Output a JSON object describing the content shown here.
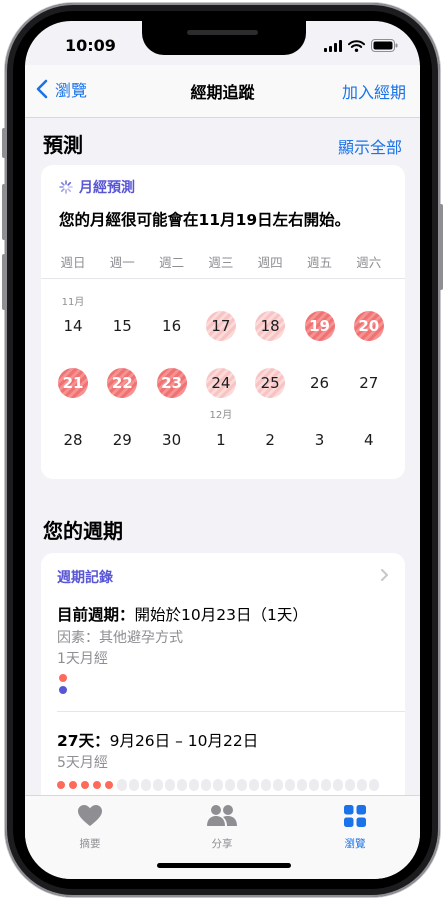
{
  "status": {
    "time": "10:09"
  },
  "nav": {
    "back_label": "瀏覽",
    "title": "經期追蹤",
    "action_label": "加入經期"
  },
  "prediction": {
    "section_title": "預測",
    "show_all_label": "顯示全部",
    "card_title": "月經預測",
    "message": "您的月經很可能會在11月19日左右開始。",
    "weekdays": [
      "週日",
      "週一",
      "週二",
      "週三",
      "週四",
      "週五",
      "週六"
    ],
    "weeks": [
      {
        "month_label": "11月",
        "month_col": 0,
        "days": [
          {
            "d": "14",
            "s": ""
          },
          {
            "d": "15",
            "s": ""
          },
          {
            "d": "16",
            "s": ""
          },
          {
            "d": "17",
            "s": "light"
          },
          {
            "d": "18",
            "s": "light"
          },
          {
            "d": "19",
            "s": "dark"
          },
          {
            "d": "20",
            "s": "dark"
          }
        ]
      },
      {
        "month_label": "",
        "month_col": -1,
        "days": [
          {
            "d": "21",
            "s": "dark"
          },
          {
            "d": "22",
            "s": "dark"
          },
          {
            "d": "23",
            "s": "dark"
          },
          {
            "d": "24",
            "s": "light"
          },
          {
            "d": "25",
            "s": "light"
          },
          {
            "d": "26",
            "s": ""
          },
          {
            "d": "27",
            "s": ""
          }
        ]
      },
      {
        "month_label": "12月",
        "month_col": 3,
        "days": [
          {
            "d": "28",
            "s": ""
          },
          {
            "d": "29",
            "s": ""
          },
          {
            "d": "30",
            "s": ""
          },
          {
            "d": "1",
            "s": ""
          },
          {
            "d": "2",
            "s": ""
          },
          {
            "d": "3",
            "s": ""
          },
          {
            "d": "4",
            "s": ""
          }
        ]
      }
    ]
  },
  "cycles": {
    "section_title": "您的週期",
    "history_link": "週期記錄",
    "current": {
      "label": "目前週期：",
      "value": "開始於10月23日（1天）",
      "factor": "因素：其他避孕方式",
      "period": "1天月經"
    },
    "previous": {
      "label": "27天：",
      "value": "9月26日 – 10月22日",
      "period": "5天月經",
      "period_days": 5,
      "total_days": 27
    }
  },
  "tabs": [
    {
      "label": "摘要",
      "icon": "heart-icon",
      "active": false
    },
    {
      "label": "分享",
      "icon": "people-icon",
      "active": false
    },
    {
      "label": "瀏覽",
      "icon": "grid-icon",
      "active": true
    }
  ],
  "colors": {
    "accent_blue": "#1a73e8",
    "accent_purple": "#5856d6",
    "period_dark": "#f07272",
    "period_light": "#f8c3c3"
  }
}
